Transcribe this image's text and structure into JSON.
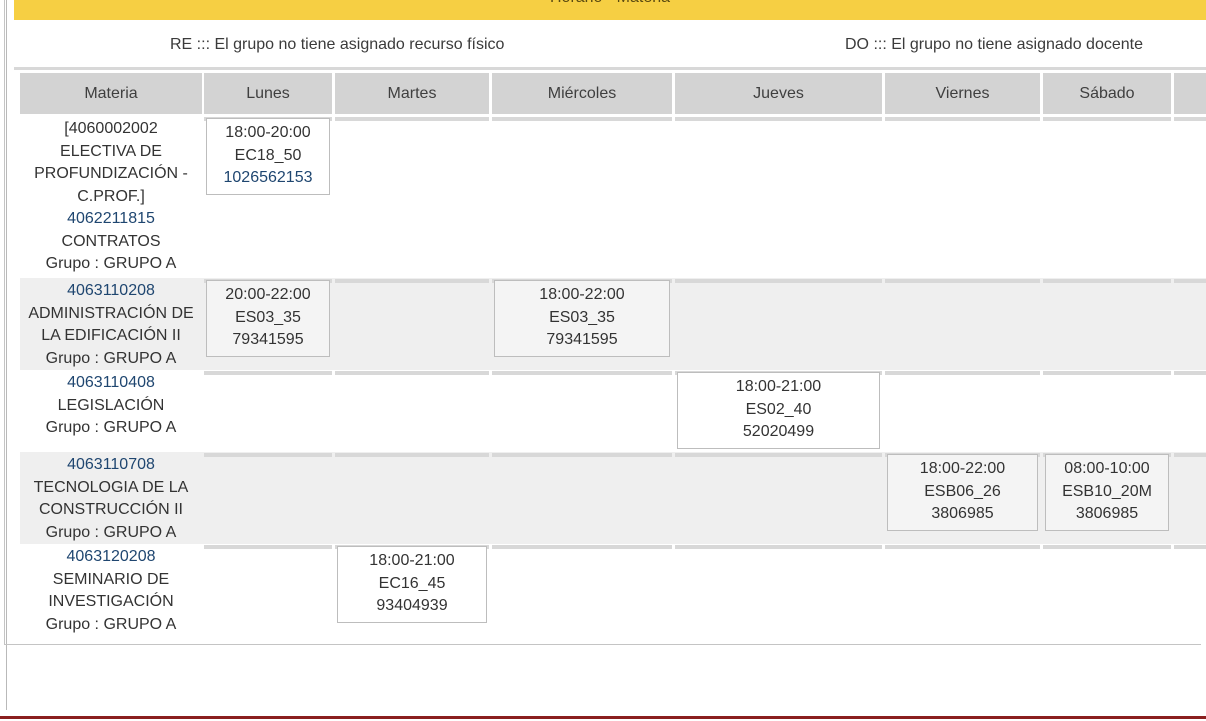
{
  "title": "Horario - Materia",
  "legend": {
    "re": "RE ::: El grupo no tiene asignado recurso físico",
    "do": "DO ::: El grupo no tiene asignado docente"
  },
  "headers": [
    "Materia",
    "Lunes",
    "Martes",
    "Miércoles",
    "Jueves",
    "Viernes",
    "Sábado"
  ],
  "rows": [
    {
      "lines": [
        "[4060002002",
        "ELECTIVA DE",
        "PROFUNDIZACIÓN -",
        "C.PROF.]",
        "4062211815",
        "CONTRATOS",
        "Grupo : GRUPO A"
      ],
      "link_lines": [
        4
      ],
      "sessions": [
        {
          "day": "Lunes",
          "time": "18:00-20:00",
          "room": "EC18_50",
          "teacher": "1026562153",
          "teacher_link": true
        }
      ]
    },
    {
      "lines": [
        "4063110208",
        "ADMINISTRACIÓN DE",
        "LA EDIFICACIÓN II",
        "Grupo : GRUPO A"
      ],
      "link_lines": [
        0
      ],
      "sessions": [
        {
          "day": "Lunes",
          "time": "20:00-22:00",
          "room": "ES03_35",
          "teacher": "79341595",
          "teacher_link": false
        },
        {
          "day": "Miércoles",
          "time": "18:00-22:00",
          "room": "ES03_35",
          "teacher": "79341595",
          "teacher_link": false
        }
      ]
    },
    {
      "lines": [
        "4063110408",
        "LEGISLACIÓN",
        "Grupo : GRUPO A"
      ],
      "link_lines": [
        0
      ],
      "sessions": [
        {
          "day": "Jueves",
          "time": "18:00-21:00",
          "room": "ES02_40",
          "teacher": "52020499",
          "teacher_link": false
        }
      ]
    },
    {
      "lines": [
        "4063110708",
        "TECNOLOGIA DE LA",
        "CONSTRUCCIÓN II",
        "Grupo : GRUPO A"
      ],
      "link_lines": [
        0
      ],
      "sessions": [
        {
          "day": "Viernes",
          "time": "18:00-22:00",
          "room": "ESB06_26",
          "teacher": "3806985",
          "teacher_link": false
        },
        {
          "day": "Sábado",
          "time": "08:00-10:00",
          "room": "ESB10_20M",
          "teacher": "3806985",
          "teacher_link": false
        }
      ]
    },
    {
      "lines": [
        "4063120208",
        "SEMINARIO DE",
        "INVESTIGACIÓN",
        "Grupo : GRUPO A"
      ],
      "link_lines": [
        0
      ],
      "sessions": [
        {
          "day": "Martes",
          "time": "18:00-21:00",
          "room": "EC16_45",
          "teacher": "93404939",
          "teacher_link": false
        }
      ]
    }
  ]
}
